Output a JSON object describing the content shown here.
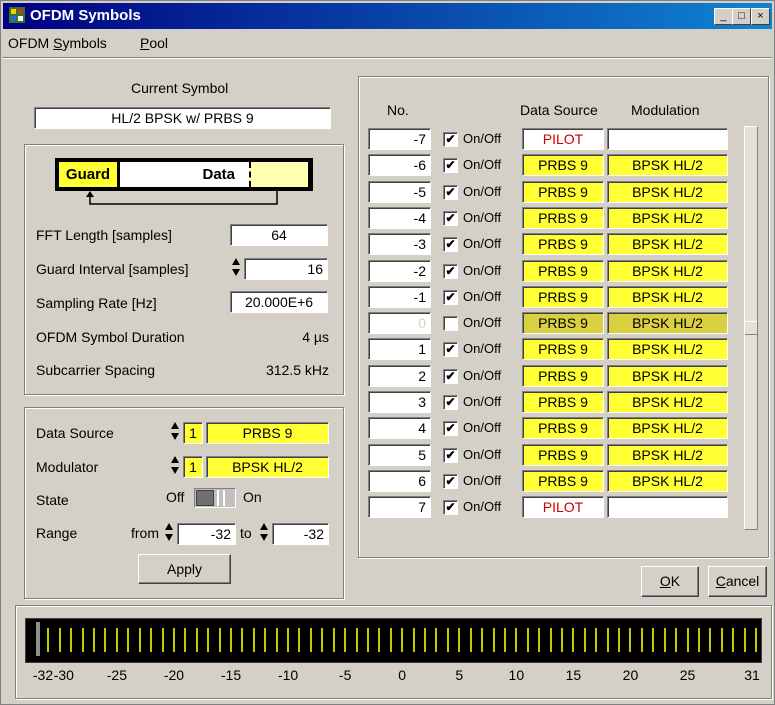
{
  "window": {
    "title": "OFDM Symbols",
    "min_glyph": "_",
    "max_glyph": "□",
    "close_glyph": "×"
  },
  "menu": {
    "item1_pre": "OFDM ",
    "item1_u": "S",
    "item1_post": "ymbols",
    "item2_u": "P",
    "item2_post": "ool"
  },
  "current_symbol": {
    "label": "Current Symbol",
    "value": "HL/2 BPSK w/ PRBS 9"
  },
  "diagram": {
    "guard": "Guard",
    "data": "Data"
  },
  "params": {
    "fft_label": "FFT Length [samples]",
    "fft_value": "64",
    "guard_label": "Guard Interval [samples]",
    "guard_value": "16",
    "rate_label": "Sampling Rate [Hz]",
    "rate_value": "20.000E+6",
    "duration_label": "OFDM Symbol Duration",
    "duration_value": "4 µs",
    "spacing_label": "Subcarrier Spacing",
    "spacing_value": "312.5 kHz"
  },
  "editor": {
    "ds_label": "Data Source",
    "ds_index": "1",
    "ds_value": "PRBS 9",
    "mod_label": "Modulator",
    "mod_index": "1",
    "mod_value": "BPSK HL/2",
    "state_label": "State",
    "state_off": "Off",
    "state_on": "On",
    "range_label": "Range",
    "from_label": "from",
    "from_value": "-32",
    "to_label": "to",
    "to_value": "-32",
    "apply": "Apply"
  },
  "table": {
    "headers": {
      "no": "No.",
      "source": "Data Source",
      "modulation": "Modulation"
    },
    "onoff": "On/Off",
    "rows": [
      {
        "no": "-7",
        "checked": "✔",
        "source": "PILOT",
        "modulation": "",
        "type": "pilot"
      },
      {
        "no": "-6",
        "checked": "✔",
        "source": "PRBS 9",
        "modulation": "BPSK HL/2",
        "type": "data"
      },
      {
        "no": "-5",
        "checked": "✔",
        "source": "PRBS 9",
        "modulation": "BPSK HL/2",
        "type": "data"
      },
      {
        "no": "-4",
        "checked": "✔",
        "source": "PRBS 9",
        "modulation": "BPSK HL/2",
        "type": "data"
      },
      {
        "no": "-3",
        "checked": "✔",
        "source": "PRBS 9",
        "modulation": "BPSK HL/2",
        "type": "data"
      },
      {
        "no": "-2",
        "checked": "✔",
        "source": "PRBS 9",
        "modulation": "BPSK HL/2",
        "type": "data"
      },
      {
        "no": "-1",
        "checked": "✔",
        "source": "PRBS 9",
        "modulation": "BPSK HL/2",
        "type": "data"
      },
      {
        "no": "0",
        "checked": "",
        "source": "PRBS 9",
        "modulation": "BPSK HL/2",
        "type": "off"
      },
      {
        "no": "1",
        "checked": "✔",
        "source": "PRBS 9",
        "modulation": "BPSK HL/2",
        "type": "data"
      },
      {
        "no": "2",
        "checked": "✔",
        "source": "PRBS 9",
        "modulation": "BPSK HL/2",
        "type": "data"
      },
      {
        "no": "3",
        "checked": "✔",
        "source": "PRBS 9",
        "modulation": "BPSK HL/2",
        "type": "data"
      },
      {
        "no": "4",
        "checked": "✔",
        "source": "PRBS 9",
        "modulation": "BPSK HL/2",
        "type": "data"
      },
      {
        "no": "5",
        "checked": "✔",
        "source": "PRBS 9",
        "modulation": "BPSK HL/2",
        "type": "data"
      },
      {
        "no": "6",
        "checked": "✔",
        "source": "PRBS 9",
        "modulation": "BPSK HL/2",
        "type": "data"
      },
      {
        "no": "7",
        "checked": "✔",
        "source": "PILOT",
        "modulation": "",
        "type": "pilot"
      }
    ]
  },
  "buttons": {
    "ok_u": "O",
    "ok_post": "K",
    "cancel_u": "C",
    "cancel_post": "ancel"
  },
  "spectrum": {
    "axis_min": -32,
    "axis_max": 31,
    "tick_labels": [
      "-32",
      "-30",
      "-25",
      "-20",
      "-15",
      "-10",
      "-5",
      "0",
      "5",
      "10",
      "15",
      "20",
      "25",
      "31"
    ]
  },
  "colors": {
    "active": "#ffff33",
    "pilot_text": "#cc0000",
    "off_cell": "#d8d040"
  }
}
